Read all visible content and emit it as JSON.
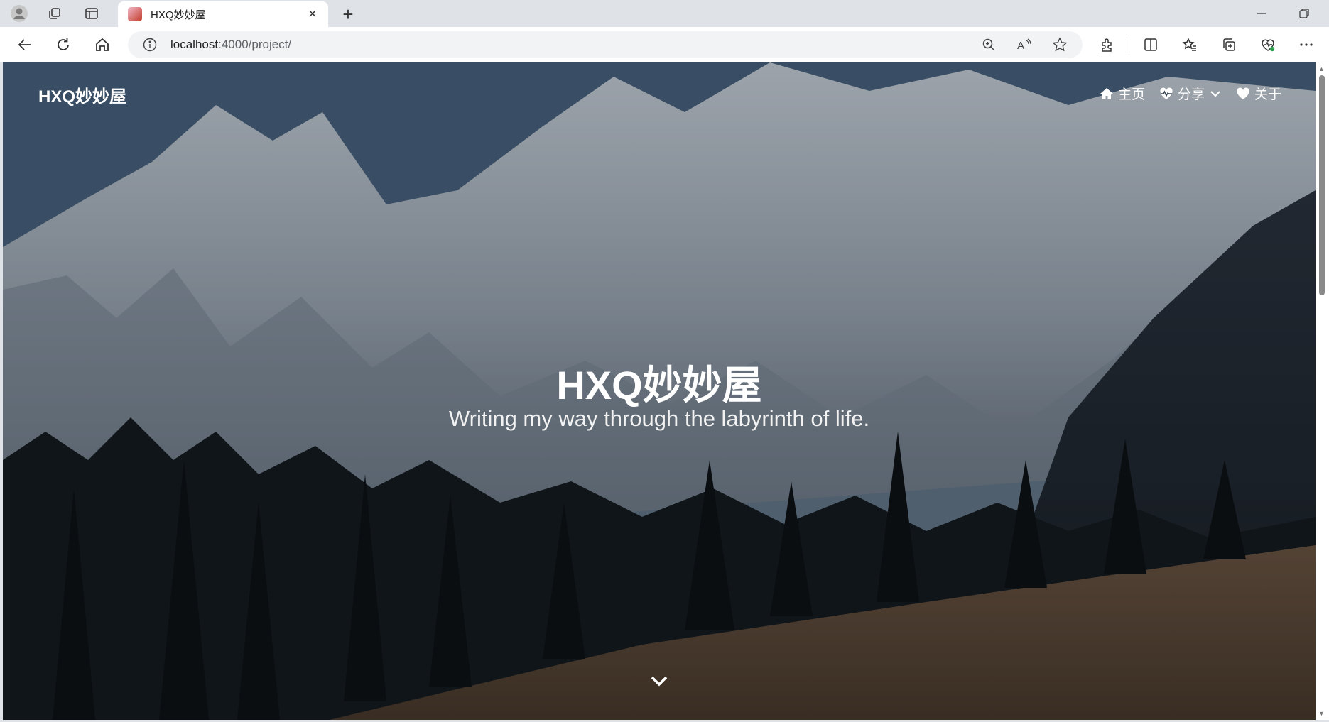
{
  "browser": {
    "tab_title": "HXQ妙妙屋",
    "url_host": "localhost",
    "url_path": ":4000/project/"
  },
  "site": {
    "brand": "HXQ妙妙屋",
    "nav": [
      {
        "label": "主页",
        "icon": "home-icon"
      },
      {
        "label": "分享",
        "icon": "heartbeat-icon"
      },
      {
        "label": "关于",
        "icon": "heart-icon"
      }
    ],
    "hero_title": "HXQ妙妙屋",
    "hero_subtitle": "Writing my way through the labyrinth of life."
  }
}
